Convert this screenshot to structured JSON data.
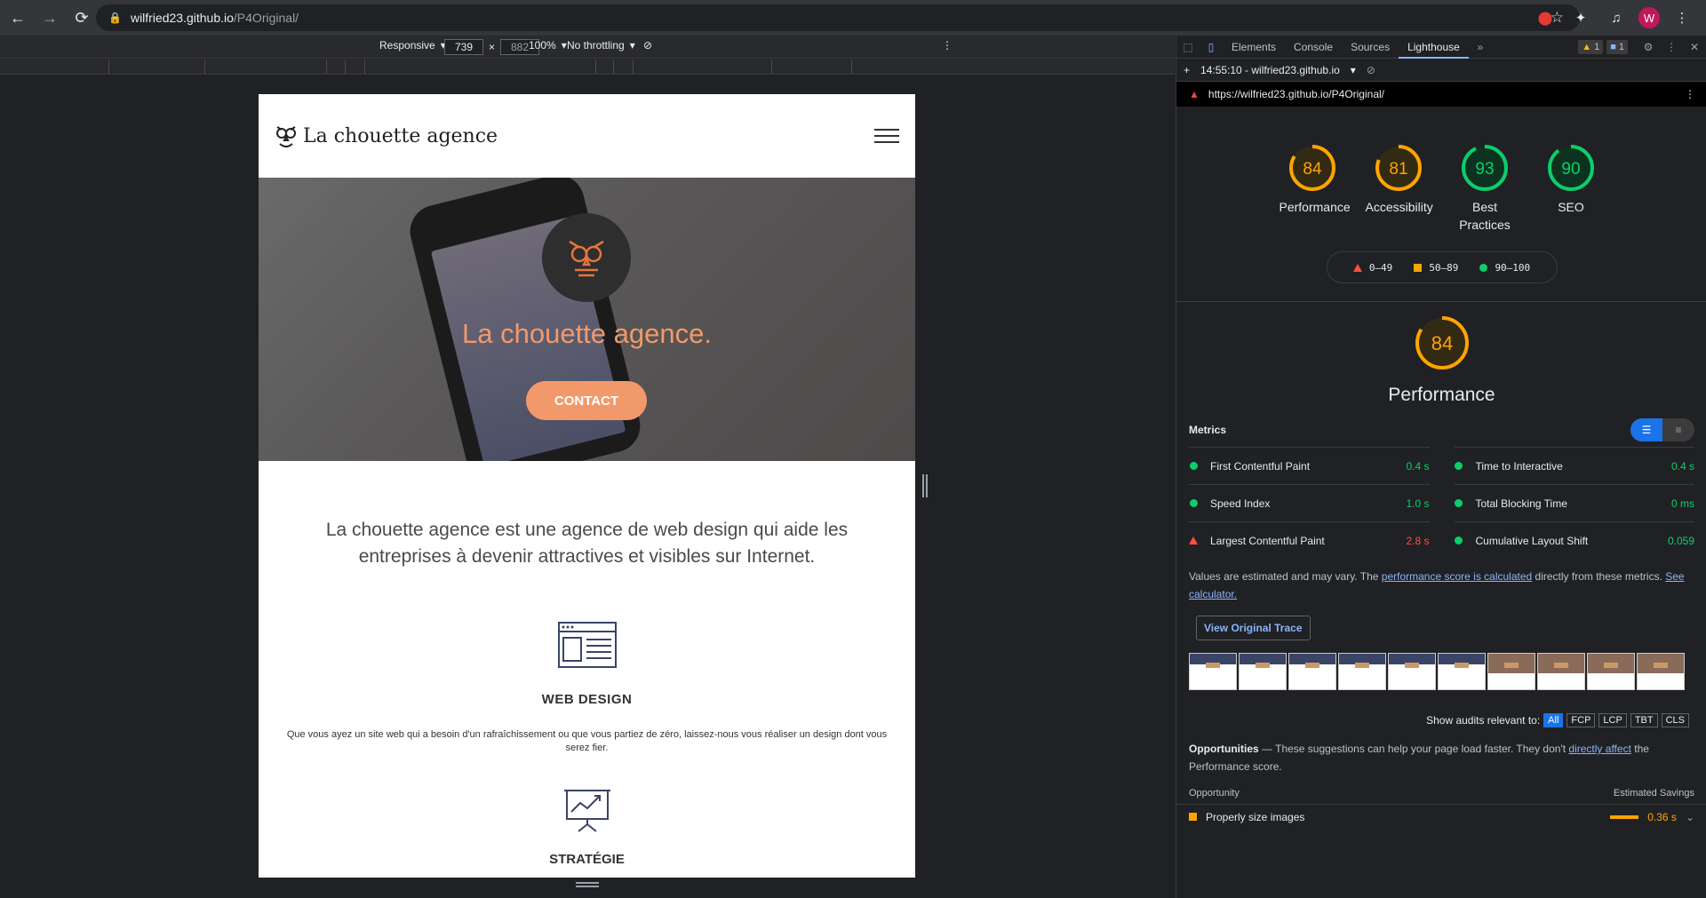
{
  "browser": {
    "url_host": "wilfried23.github.io",
    "url_path": "/P4Original/",
    "avatar_letter": "W"
  },
  "device_toolbar": {
    "mode": "Responsive",
    "width": "739",
    "height": "882",
    "zoom": "100%",
    "throttling": "No throttling"
  },
  "site": {
    "logo_text": "La chouette agence",
    "hero_title": "La chouette agence.",
    "contact_label": "CONTACT",
    "intro": "La chouette agence est une agence de web design qui aide les entreprises à devenir attractives et visibles sur Internet.",
    "services": [
      {
        "title": "WEB DESIGN",
        "text": "Que vous ayez un site web qui a besoin d'un rafraîchissement ou que vous partiez de zéro, laissez-nous vous réaliser un design dont vous serez fier."
      },
      {
        "title": "STRATÉGIE"
      }
    ]
  },
  "devtools": {
    "tabs": [
      "Elements",
      "Console",
      "Sources",
      "Lighthouse"
    ],
    "active_tab": "Lighthouse",
    "warn_count": "1",
    "msg_count": "1",
    "report_label": "14:55:10 - wilfried23.github.io",
    "report_url": "https://wilfried23.github.io/P4Original/"
  },
  "lighthouse": {
    "scores": [
      {
        "label": "Performance",
        "value": 84,
        "color": "#ffa400"
      },
      {
        "label": "Accessibility",
        "value": 81,
        "color": "#ffa400"
      },
      {
        "label": "Best Practices",
        "value": 93,
        "color": "#0cce6b"
      },
      {
        "label": "SEO",
        "value": 90,
        "color": "#0cce6b"
      }
    ],
    "legend": {
      "bad": "0–49",
      "avg": "50–89",
      "good": "90–100"
    },
    "perf_score": "84",
    "perf_title": "Performance",
    "metrics_title": "Metrics",
    "metrics": [
      {
        "name": "First Contentful Paint",
        "value": "0.4 s",
        "status": "good"
      },
      {
        "name": "Time to Interactive",
        "value": "0.4 s",
        "status": "good"
      },
      {
        "name": "Speed Index",
        "value": "1.0 s",
        "status": "good"
      },
      {
        "name": "Total Blocking Time",
        "value": "0 ms",
        "status": "good"
      },
      {
        "name": "Largest Contentful Paint",
        "value": "2.8 s",
        "status": "bad"
      },
      {
        "name": "Cumulative Layout Shift",
        "value": "0.059",
        "status": "good"
      }
    ],
    "note_pre": "Values are estimated and may vary. The ",
    "note_link1": "performance score is calculated",
    "note_mid": " directly from these metrics. ",
    "note_link2": "See calculator.",
    "trace_button": "View Original Trace",
    "filter_label": "Show audits relevant to:",
    "filters": [
      "All",
      "FCP",
      "LCP",
      "TBT",
      "CLS"
    ],
    "opps_title": "Opportunities",
    "opps_text_pre": " — These suggestions can help your page load faster. They don't ",
    "opps_link": "directly affect",
    "opps_text_post": " the Performance score.",
    "opp_col1": "Opportunity",
    "opp_col2": "Estimated Savings",
    "opp_row": {
      "name": "Properly size images",
      "savings": "0.36 s"
    }
  }
}
